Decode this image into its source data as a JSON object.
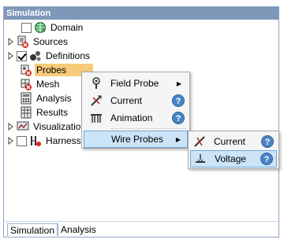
{
  "panel": {
    "title": "Simulation"
  },
  "tree": {
    "domain": "Domain",
    "sources": "Sources",
    "definitions": "Definitions",
    "probes": "Probes",
    "mesh": "Mesh",
    "analysis": "Analysis",
    "results": "Results",
    "visualization": "Visualization",
    "harness": "Harness"
  },
  "tabs": {
    "simulation": "Simulation",
    "analysis": "Analysis"
  },
  "context_menu": {
    "field_probe": "Field Probe",
    "current": "Current",
    "animation": "Animation",
    "wire_probes": "Wire Probes",
    "help_glyph": "?"
  },
  "submenu": {
    "current": "Current",
    "voltage": "Voltage",
    "help_glyph": "?"
  },
  "colors": {
    "title_bar": "#7f97b8",
    "selection": "#f7cb7a",
    "menu_highlight": "#cce4f7",
    "help_icon": "#4a83c6"
  }
}
